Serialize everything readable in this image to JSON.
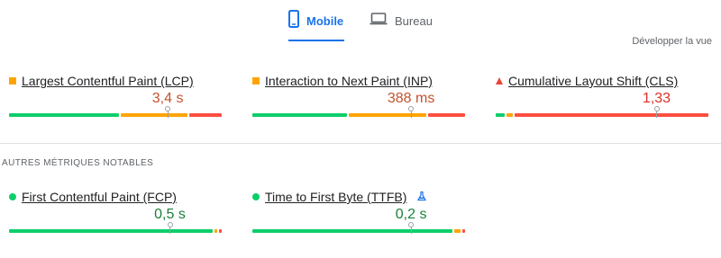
{
  "tabs": {
    "mobile": "Mobile",
    "desktop": "Bureau",
    "active": "mobile"
  },
  "expand_label": "Développer la vue",
  "colors": {
    "good": "#0cce6b",
    "needs_improvement": "#ffa400",
    "poor": "#ff4e42",
    "accent": "#1a73e8"
  },
  "core_metrics": [
    {
      "name": "Largest Contentful Paint (LCP)",
      "value": "3,4 s",
      "rating": "needs-improvement",
      "marker": "square",
      "value_color": "#c5522e",
      "marker_position_fraction": 0.74,
      "distribution": {
        "good": 0.52,
        "needs_improvement": 0.32,
        "poor": 0.16
      }
    },
    {
      "name": "Interaction to Next Paint (INP)",
      "value": "388 ms",
      "rating": "needs-improvement",
      "marker": "square",
      "value_color": "#c5522e",
      "marker_position_fraction": 0.74,
      "distribution": {
        "good": 0.45,
        "needs_improvement": 0.37,
        "poor": 0.18
      }
    },
    {
      "name": "Cumulative Layout Shift (CLS)",
      "value": "1,33",
      "rating": "poor",
      "marker": "triangle",
      "value_color": "#d93025",
      "marker_position_fraction": 0.75,
      "distribution": {
        "good": 0.05,
        "needs_improvement": 0.04,
        "poor": 0.91
      }
    }
  ],
  "other_section_title": "AUTRES MÉTRIQUES NOTABLES",
  "other_metrics": [
    {
      "name": "First Contentful Paint (FCP)",
      "value": "0,5 s",
      "rating": "good",
      "marker": "circle",
      "value_color": "#188038",
      "marker_position_fraction": 0.75,
      "distribution": {
        "good": 0.96,
        "needs_improvement": 0.02,
        "poor": 0.02
      },
      "experimental": false
    },
    {
      "name": "Time to First Byte (TTFB)",
      "value": "0,2 s",
      "rating": "good",
      "marker": "circle",
      "value_color": "#188038",
      "marker_position_fraction": 0.74,
      "distribution": {
        "good": 0.94,
        "needs_improvement": 0.04,
        "poor": 0.02
      },
      "experimental": true
    }
  ]
}
